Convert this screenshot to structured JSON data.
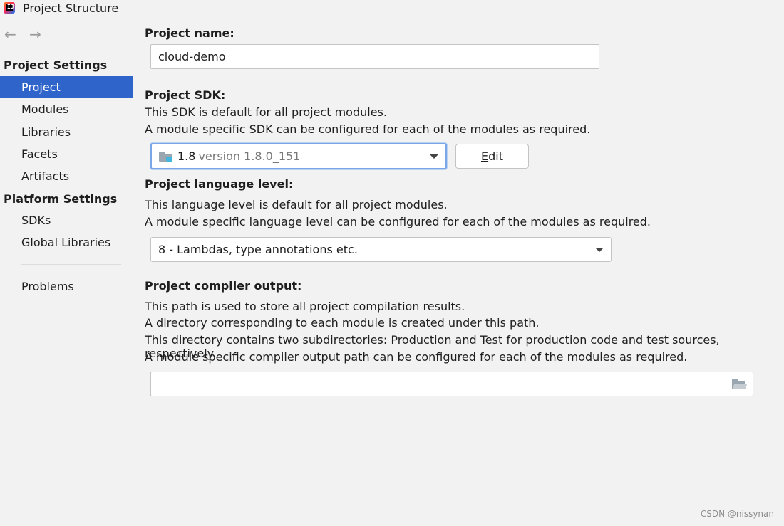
{
  "window": {
    "title": "Project Structure"
  },
  "nav": {
    "back": "←",
    "forward": "→"
  },
  "sidebar": {
    "project_settings_header": "Project Settings",
    "project_items": [
      "Project",
      "Modules",
      "Libraries",
      "Facets",
      "Artifacts"
    ],
    "platform_settings_header": "Platform Settings",
    "platform_items": [
      "SDKs",
      "Global Libraries"
    ],
    "problems": "Problems",
    "selected": "Project"
  },
  "main": {
    "project_name": {
      "label": "Project name:",
      "value": "cloud-demo"
    },
    "sdk": {
      "label": "Project SDK:",
      "desc1": "This SDK is default for all project modules.",
      "desc2": "A module specific SDK can be configured for each of the modules as required.",
      "selected_name": "1.8",
      "selected_version": "version 1.8.0_151",
      "edit_mnemonic": "E",
      "edit_rest": "dit"
    },
    "language_level": {
      "label": "Project language level:",
      "desc1": "This language level is default for all project modules.",
      "desc2": "A module specific language level can be configured for each of the modules as required.",
      "selected": "8 - Lambdas, type annotations etc."
    },
    "compiler_output": {
      "label": "Project compiler output:",
      "desc1": "This path is used to store all project compilation results.",
      "desc2": "A directory corresponding to each module is created under this path.",
      "desc3": "This directory contains two subdirectories: Production and Test for production code and test sources, respectively.",
      "desc4": "A module specific compiler output path can be configured for each of the modules as required.",
      "value": ""
    }
  },
  "watermark": "CSDN @nissynan",
  "colors": {
    "selection": "#2f65ca",
    "background": "#f2f2f2",
    "focus_ring": "#7aa6e6"
  }
}
